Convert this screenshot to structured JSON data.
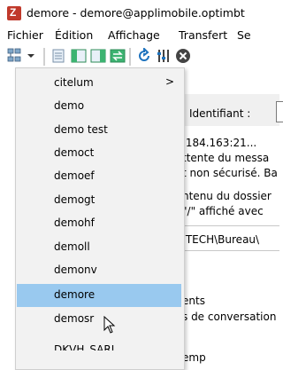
{
  "window": {
    "title": "demore - demore@applimobile.optimbt"
  },
  "menubar": {
    "items": [
      "Fichier",
      "Édition",
      "Affichage",
      "Transfert",
      "Se"
    ]
  },
  "panel": {
    "identifiant_label": "Identifiant :",
    "log_lines": [
      ".184.163:21...",
      "ttente du messa",
      "t non sécurisé. Ba",
      "ntenu du dossier",
      "\"/\" affiché avec",
      ".TECH\\Bureau\\",
      "ents",
      "s de conversation",
      "emp"
    ]
  },
  "dropdown": {
    "items": [
      {
        "label": "citelum",
        "has_submenu": true
      },
      {
        "label": "demo"
      },
      {
        "label": "demo test"
      },
      {
        "label": "democt"
      },
      {
        "label": "demoef"
      },
      {
        "label": "demogt"
      },
      {
        "label": "demohf"
      },
      {
        "label": "demoll"
      },
      {
        "label": "demonv"
      },
      {
        "label": "demore",
        "selected": true
      },
      {
        "label": "demosr"
      },
      {
        "label": "DKVH_SARL"
      }
    ],
    "submenu_arrow": ">"
  },
  "colors": {
    "selected_bg": "#99c9ef",
    "dropdown_bg": "#f2f2f2",
    "app_icon": "#c0392b"
  }
}
